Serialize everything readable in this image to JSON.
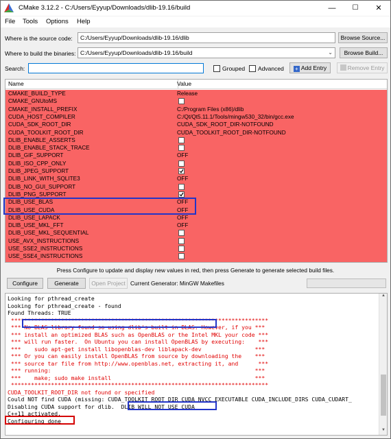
{
  "window": {
    "title": "CMake 3.12.2 - C:/Users/Eyyup/Downloads/dlib-19.16/build",
    "minimize": "—",
    "maximize": "☐",
    "close": "✕"
  },
  "menu": [
    "File",
    "Tools",
    "Options",
    "Help"
  ],
  "source": {
    "label": "Where is the source code:",
    "value": "C:/Users/Eyyup/Downloads/dlib-19.16/dlib",
    "browse": "Browse Source..."
  },
  "build": {
    "label": "Where to build the binaries:",
    "value": "C:/Users/Eyyup/Downloads/dlib-19.16/build",
    "browse": "Browse Build..."
  },
  "search": {
    "label": "Search:",
    "value": "",
    "grouped": "Grouped",
    "advanced": "Advanced",
    "add_entry": "Add Entry",
    "remove_entry": "Remove Entry"
  },
  "table": {
    "col_name": "Name",
    "col_value": "Value",
    "rows": [
      {
        "name": "CMAKE_BUILD_TYPE",
        "kind": "text",
        "value": "Release"
      },
      {
        "name": "CMAKE_GNUtoMS",
        "kind": "check",
        "checked": false
      },
      {
        "name": "CMAKE_INSTALL_PREFIX",
        "kind": "text",
        "value": "C:/Program Files (x86)/dlib"
      },
      {
        "name": "CUDA_HOST_COMPILER",
        "kind": "text",
        "value": "C:/Qt/Qt5.11.1/Tools/mingw530_32/bin/gcc.exe"
      },
      {
        "name": "CUDA_SDK_ROOT_DIR",
        "kind": "text",
        "value": "CUDA_SDK_ROOT_DIR-NOTFOUND"
      },
      {
        "name": "CUDA_TOOLKIT_ROOT_DIR",
        "kind": "text",
        "value": "CUDA_TOOLKIT_ROOT_DIR-NOTFOUND"
      },
      {
        "name": "DLIB_ENABLE_ASSERTS",
        "kind": "check",
        "checked": false
      },
      {
        "name": "DLIB_ENABLE_STACK_TRACE",
        "kind": "check",
        "checked": false
      },
      {
        "name": "DLIB_GIF_SUPPORT",
        "kind": "text",
        "value": "OFF"
      },
      {
        "name": "DLIB_ISO_CPP_ONLY",
        "kind": "check",
        "checked": false
      },
      {
        "name": "DLIB_JPEG_SUPPORT",
        "kind": "check",
        "checked": true
      },
      {
        "name": "DLIB_LINK_WITH_SQLITE3",
        "kind": "text",
        "value": "OFF"
      },
      {
        "name": "DLIB_NO_GUI_SUPPORT",
        "kind": "check",
        "checked": false
      },
      {
        "name": "DLIB_PNG_SUPPORT",
        "kind": "check",
        "checked": true
      },
      {
        "name": "DLIB_USE_BLAS",
        "kind": "text",
        "value": "OFF"
      },
      {
        "name": "DLIB_USE_CUDA",
        "kind": "text",
        "value": "OFF"
      },
      {
        "name": "DLIB_USE_LAPACK",
        "kind": "text",
        "value": "OFF"
      },
      {
        "name": "DLIB_USE_MKL_FFT",
        "kind": "text",
        "value": "OFF"
      },
      {
        "name": "DLIB_USE_MKL_SEQUENTIAL",
        "kind": "check",
        "checked": false
      },
      {
        "name": "USE_AVX_INSTRUCTIONS",
        "kind": "check",
        "checked": false
      },
      {
        "name": "USE_SSE2_INSTRUCTIONS",
        "kind": "check",
        "checked": false
      },
      {
        "name": "USE_SSE4_INSTRUCTIONS",
        "kind": "check",
        "checked": false
      }
    ]
  },
  "status_message": "Press Configure to update and display new values in red, then press Generate to generate selected build files.",
  "actions": {
    "configure": "Configure",
    "generate": "Generate",
    "open_project": "Open Project",
    "current_generator": "Current Generator: MinGW Makefiles"
  },
  "log": [
    {
      "text": "Looking for pthread_create",
      "red": false
    },
    {
      "text": "Looking for pthread_create - found",
      "red": false
    },
    {
      "text": "Found Threads: TRUE",
      "red": false
    },
    {
      "text": " *****************************************************************************",
      "red": true
    },
    {
      "text": " *** No BLAS library found so using dlib's built in BLAS. However, if you ***",
      "red": true
    },
    {
      "text": " *** install an optimized BLAS such as OpenBLAS or the Intel MKL your code ***",
      "red": true
    },
    {
      "text": " *** will run faster.  On Ubuntu you can install OpenBLAS by executing:    ***",
      "red": true
    },
    {
      "text": " ***    sudo apt-get install libopenblas-dev liblapack-dev                ***",
      "red": true
    },
    {
      "text": " *** Or you can easily install OpenBLAS from source by downloading the    ***",
      "red": true
    },
    {
      "text": " *** source tar file from http://www.openblas.net, extracting it, and      ***",
      "red": true
    },
    {
      "text": " *** running:                                                             ***",
      "red": true
    },
    {
      "text": " ***    make; sudo make install                                           ***",
      "red": true
    },
    {
      "text": " *****************************************************************************",
      "red": true
    },
    {
      "text": "CUDA_TOOLKIT_ROOT_DIR not found or specified",
      "red": true
    },
    {
      "text": "Could NOT find CUDA (missing: CUDA_TOOLKIT_ROOT_DIR CUDA_NVCC_EXECUTABLE CUDA_INCLUDE_DIRS CUDA_CUDART_",
      "red": false
    },
    {
      "text": "Disabling CUDA support for dlib.  DLIB WILL NOT USE CUDA",
      "red": false
    },
    {
      "text": "C++11 activated.",
      "red": false
    },
    {
      "text": "Configuring done",
      "red": false
    }
  ]
}
